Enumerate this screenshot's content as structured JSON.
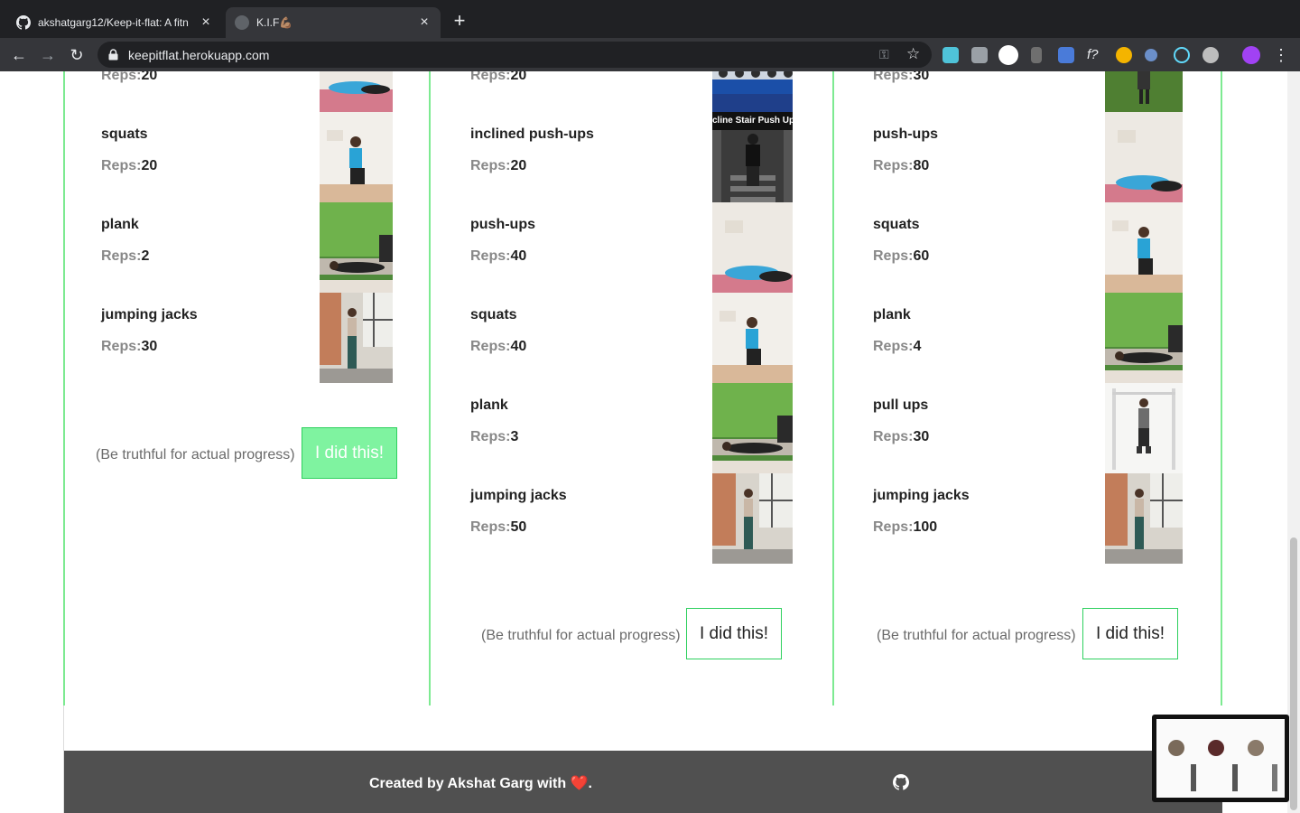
{
  "browser": {
    "tabs": [
      {
        "title": "akshatgarg12/Keep-it-flat: A fitn",
        "active": false
      },
      {
        "title": "K.I.F💪🏽",
        "active": true
      }
    ],
    "url": "keepitflat.herokuapp.com"
  },
  "columns": [
    {
      "exercises": [
        {
          "name": "",
          "reps": "20",
          "image": "push-ups"
        },
        {
          "name": "squats",
          "reps": "20",
          "image": "squats"
        },
        {
          "name": "plank",
          "reps": "2",
          "image": "plank"
        },
        {
          "name": "jumping jacks",
          "reps": "30",
          "image": "jumping-jacks"
        }
      ],
      "truth_text": "(Be truthful for actual progress)",
      "button_label": "I did this!",
      "completed": true
    },
    {
      "exercises": [
        {
          "name": "",
          "reps": "20",
          "image": "gym"
        },
        {
          "name": "inclined push-ups",
          "reps": "20",
          "image": "incline-stair-push-up"
        },
        {
          "name": "push-ups",
          "reps": "40",
          "image": "push-ups"
        },
        {
          "name": "squats",
          "reps": "40",
          "image": "squats"
        },
        {
          "name": "plank",
          "reps": "3",
          "image": "plank"
        },
        {
          "name": "jumping jacks",
          "reps": "50",
          "image": "jumping-jacks"
        }
      ],
      "truth_text": "(Be truthful for actual progress)",
      "button_label": "I did this!",
      "completed": false
    },
    {
      "exercises": [
        {
          "name": "",
          "reps": "30",
          "image": "grass"
        },
        {
          "name": "push-ups",
          "reps": "80",
          "image": "push-ups"
        },
        {
          "name": "squats",
          "reps": "60",
          "image": "squats"
        },
        {
          "name": "plank",
          "reps": "4",
          "image": "plank"
        },
        {
          "name": "pull ups",
          "reps": "30",
          "image": "pull-ups"
        },
        {
          "name": "jumping jacks",
          "reps": "100",
          "image": "jumping-jacks"
        }
      ],
      "truth_text": "(Be truthful for actual progress)",
      "button_label": "I did this!",
      "completed": false
    }
  ],
  "reps_label": "Reps:",
  "incline_caption": "cline Stair Push Up",
  "footer": {
    "credit": "Created by Akshat Garg with ❤️."
  },
  "colors": {
    "accent": "#7dea91",
    "button_done": "#7ff3a0",
    "footer_bg": "#505050"
  }
}
